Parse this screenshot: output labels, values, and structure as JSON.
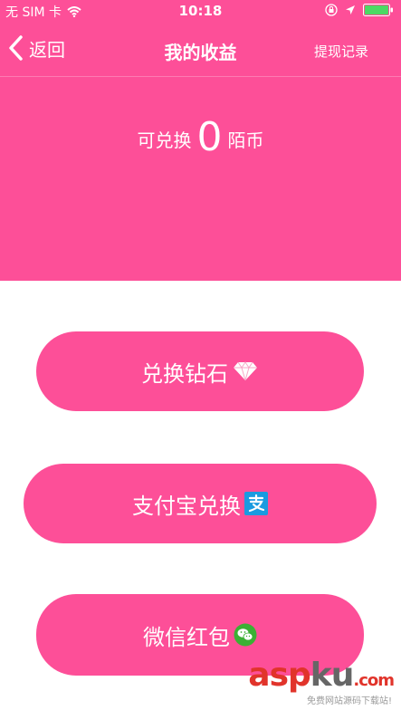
{
  "status_bar": {
    "carrier": "无 SIM 卡",
    "time": "10:18"
  },
  "nav": {
    "back_label": "返回",
    "title": "我的收益",
    "withdraw_record": "提现记录"
  },
  "balance": {
    "prefix": "可兑换",
    "amount": "0",
    "unit": "陌币"
  },
  "buttons": {
    "diamond": "兑换钻石",
    "alipay": "支付宝兑换",
    "wechat": "微信红包"
  },
  "watermark": {
    "part1": "asp",
    "part2": "ku",
    "part3": ".com",
    "subtitle": "免费网站源码下载站!"
  },
  "colors": {
    "accent_pink": "#fd4f98",
    "alipay_blue": "#1a9be0",
    "wechat_green": "#3cb034"
  }
}
